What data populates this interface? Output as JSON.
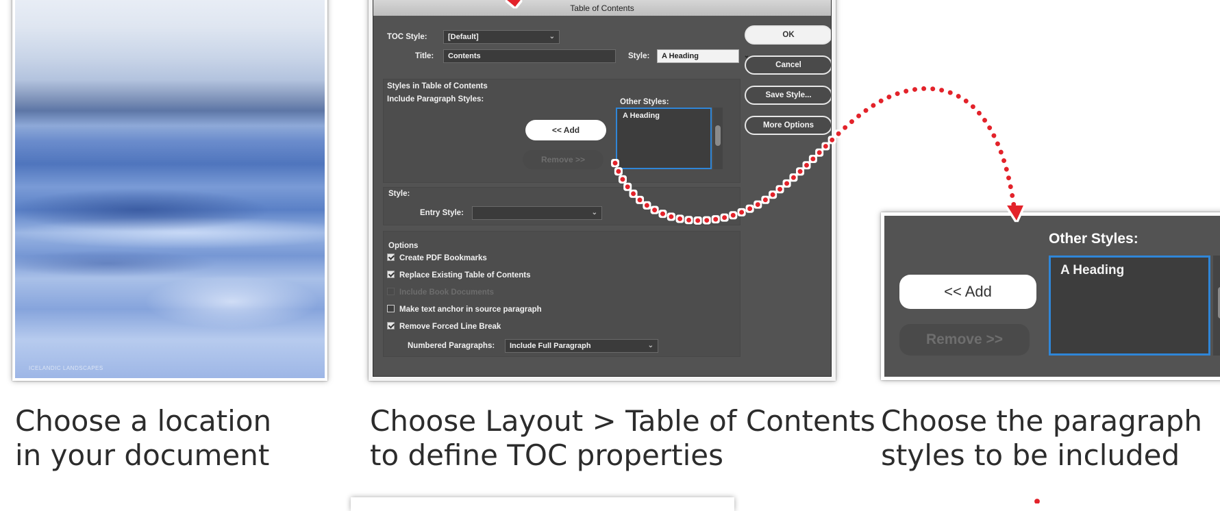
{
  "document_panel": {
    "footer_text": "ICELANDIC LANDSCAPES",
    "caption_line1": "Choose a location",
    "caption_line2": "in your document"
  },
  "dialog": {
    "title": "Table of Contents",
    "toc_style_label": "TOC Style:",
    "toc_style_value": "[Default]",
    "title_label": "Title:",
    "title_value": "Contents",
    "style_label": "Style:",
    "style_value": "A Heading",
    "buttons": {
      "ok": "OK",
      "cancel": "Cancel",
      "save_style": "Save Style...",
      "more_options": "More Options"
    },
    "styles_section_title": "Styles in Table of Contents",
    "include_paragraph_styles_label": "Include Paragraph Styles:",
    "other_styles_label": "Other Styles:",
    "other_styles_items": [
      "A Heading"
    ],
    "add_button": "<< Add",
    "remove_button": "Remove >>",
    "style_section_label": "Style:",
    "entry_style_label": "Entry Style:",
    "entry_style_value": "",
    "options_label": "Options",
    "options": [
      {
        "label": "Create PDF Bookmarks",
        "state": "checked"
      },
      {
        "label": "Replace Existing Table of Contents",
        "state": "checked"
      },
      {
        "label": "Include Book Documents",
        "state": "disabled"
      },
      {
        "label": "Make text anchor in source paragraph",
        "state": "unchecked"
      },
      {
        "label": "Remove Forced Line Break",
        "state": "checked"
      }
    ],
    "numbered_paragraphs_label": "Numbered Paragraphs:",
    "numbered_paragraphs_value": "Include Full Paragraph",
    "caption_line1": "Choose Layout > Table of Contents",
    "caption_line2": "to define TOC properties"
  },
  "zoom_panel": {
    "other_styles_label": "Other Styles:",
    "other_styles_items": [
      "A Heading"
    ],
    "add_button": "<< Add",
    "remove_button": "Remove >>",
    "caption_line1": "Choose the paragraph",
    "caption_line2": "styles to be included"
  },
  "colors": {
    "accent_red": "#e3202b",
    "dialog_bg": "#535353",
    "list_border": "#2f86d8"
  },
  "icons": [
    "chevron-down-icon",
    "checkbox-icon",
    "dotted-arrow-icon"
  ]
}
